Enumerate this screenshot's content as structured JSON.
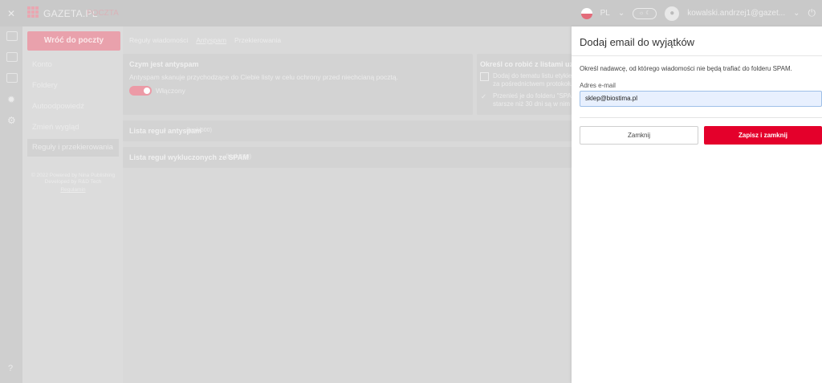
{
  "app": {
    "logo_text": "GAZETA.PL",
    "logo_sub": "POCZTA"
  },
  "topbar": {
    "lang": "PL",
    "lang_chevron": "⌄",
    "theme_toggle": "☼ ☾",
    "user_email": "kowalski.andrzej1@gazet...",
    "user_chevron": "⌄",
    "power_icon": "⏻"
  },
  "rail": {
    "close": "✕",
    "help": "?"
  },
  "sidebar": {
    "back_button": "Wróć do poczty",
    "items": [
      "Konto",
      "Foldery",
      "Autoodpowiedź",
      "Zmień wygląd",
      "Reguły i przekierowania"
    ],
    "active_index": 4,
    "footer": [
      "© 2022 Powered by Nina Publishing",
      "Developed by R&D Tech",
      "Regulamin"
    ]
  },
  "content": {
    "tabs": [
      "Reguły wiadomości",
      "Antyspam",
      "Przekierowania"
    ],
    "active_tab": 1,
    "antispam_card": {
      "title": "Czym jest antyspam",
      "text": "Antyspam skanuje przychodzące do Ciebie listy w celu ochrony przed niechcianą pocztą.",
      "toggle_label": "Włączony",
      "enabled": true
    },
    "spam_options_card": {
      "title": "Określ co robić z listami uznanym",
      "option1": "Dodaj do tematu listu etykiet",
      "option1b": "za pośrednictwem protokołu",
      "option2": "Przenieś je do folderu \"SPAM",
      "option2b": "starsze niż 30 dni są w nim a"
    },
    "rules_list": {
      "title": "Lista reguł antyspam",
      "count": "(brak/500)"
    },
    "exclusions_list": {
      "title": "Lista reguł wykluczonych ze SPAM",
      "count": "(brak/500)"
    }
  },
  "drawer": {
    "title": "Dodaj email do wyjątków",
    "description": "Określ nadawcę, od którego wiadomości nie będą trafiać do folderu SPAM.",
    "email_label": "Adres e-mail",
    "email_value": "sklep@biostima.pl",
    "close_button": "Zamknij",
    "save_button": "Zapisz i zamknij"
  },
  "colors": {
    "accent_red": "#e4002b",
    "input_bg": "#e8f0fe"
  }
}
